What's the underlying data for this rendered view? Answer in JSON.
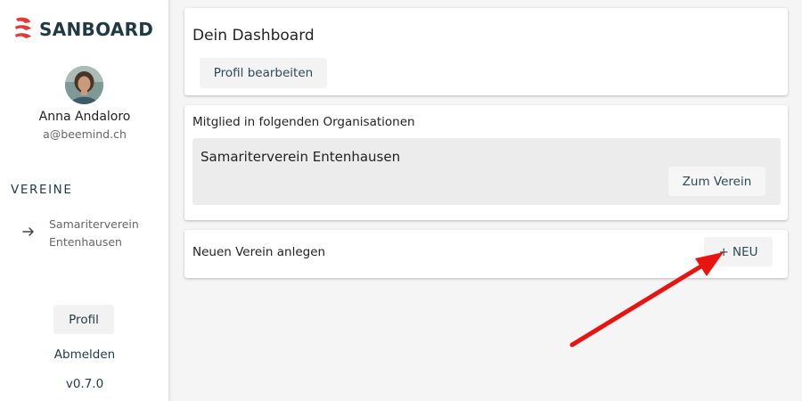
{
  "brand": {
    "name": "SANBOARD",
    "logo_icon": "sanboard-logo-icon",
    "logo_color": "#e53935"
  },
  "user": {
    "name": "Anna Andaloro",
    "email": "a@beemind.ch",
    "avatar_icon": "user-avatar-photo"
  },
  "sidebar": {
    "section_title": "VEREINE",
    "clubs": [
      {
        "label": "Samariterverein Entenhausen",
        "icon": "arrow-right-icon"
      }
    ],
    "profile_button": "Profil",
    "logout_link": "Abmelden",
    "version": "v0.7.0"
  },
  "dashboard": {
    "title": "Dein Dashboard",
    "edit_profile_button": "Profil bearbeiten"
  },
  "memberships": {
    "title": "Mitglied in folgenden Organisationen",
    "organizations": [
      {
        "name": "Samariterverein Entenhausen",
        "button": "Zum Verein"
      }
    ]
  },
  "create_club": {
    "label": "Neuen Verein anlegen",
    "button": "+ NEU"
  },
  "colors": {
    "accent_dark": "#1f3a44",
    "brand_red": "#e53935",
    "annotation_arrow": "#e8140f",
    "background": "#f5f5f5"
  }
}
